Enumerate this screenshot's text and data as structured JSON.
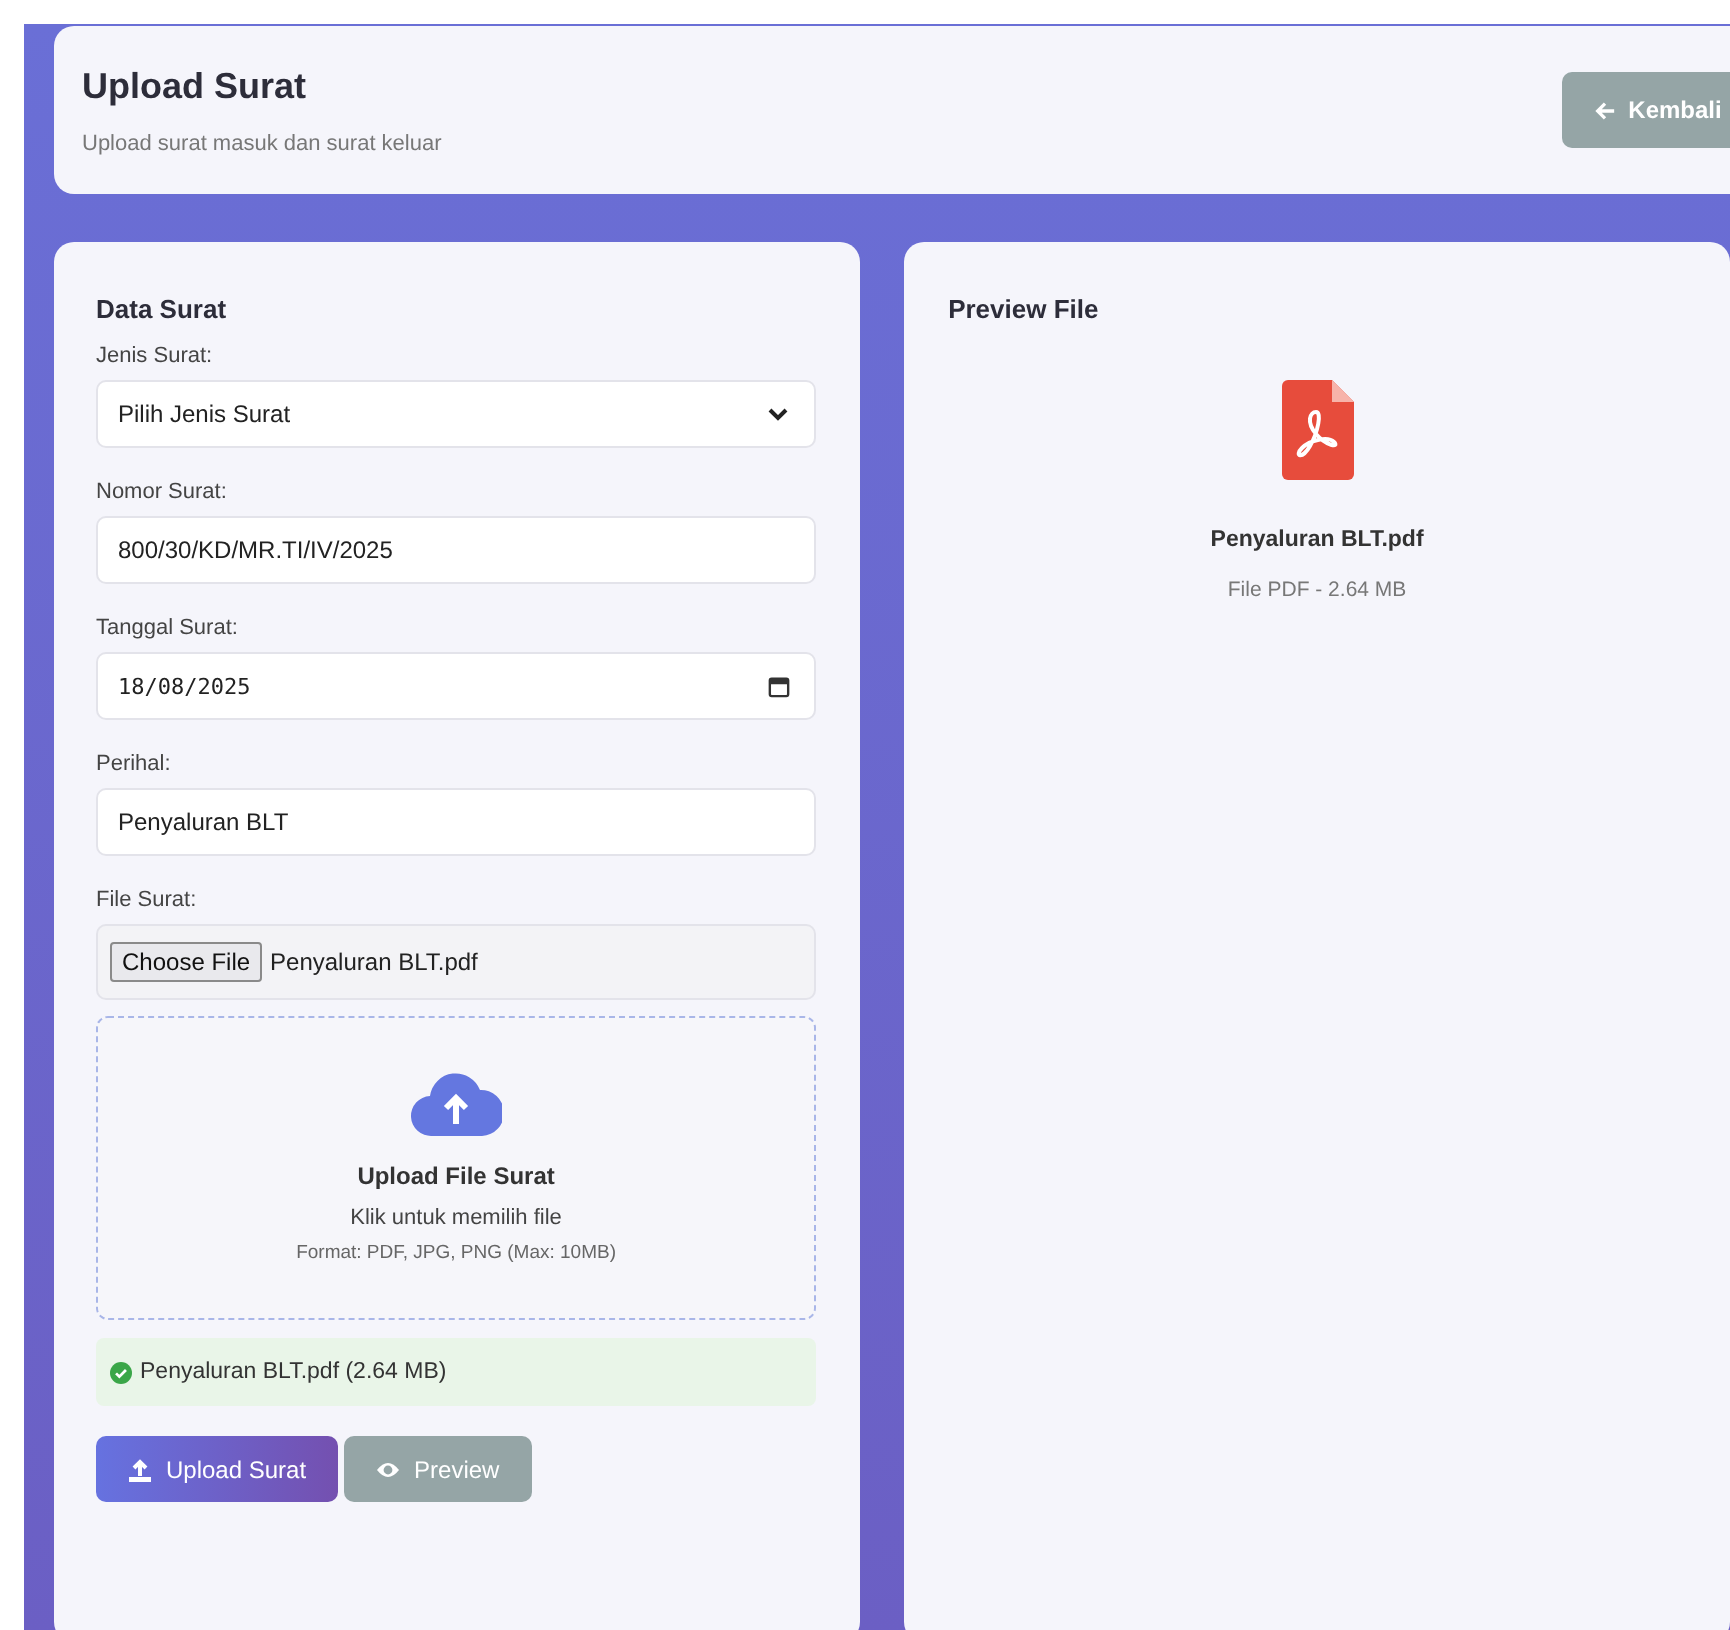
{
  "header": {
    "title": "Upload Surat",
    "subtitle": "Upload surat masuk dan surat keluar",
    "back_button": {
      "label": "Kembali"
    }
  },
  "form": {
    "title": "Data Surat",
    "fields": [
      {
        "kind": "select",
        "label": "Jenis Surat:",
        "value": "Pilih Jenis Surat"
      },
      {
        "kind": "text",
        "label": "Nomor Surat:",
        "value": "800/30/KD/MR.TI/IV/2025"
      },
      {
        "kind": "date",
        "label": "Tanggal Surat:",
        "value": "18/08/2025"
      },
      {
        "kind": "text",
        "label": "Perihal:",
        "value": "Penyaluran BLT"
      },
      {
        "kind": "file",
        "label": "File Surat:",
        "button": "Choose File",
        "value": "Penyaluran BLT.pdf"
      }
    ],
    "dropzone": {
      "title": "Upload File Surat",
      "hint": "Klik untuk memilih file",
      "formats": "Format: PDF, JPG, PNG (Max: 10MB)"
    },
    "selected_file": "Penyaluran BLT.pdf (2.64 MB)",
    "buttons": [
      {
        "kind": "primary",
        "label": "Upload Surat"
      },
      {
        "kind": "secondary",
        "label": "Preview"
      }
    ]
  },
  "preview": {
    "title": "Preview File",
    "file_name": "Penyaluran BLT.pdf",
    "file_info": "File PDF - 2.64 MB"
  }
}
